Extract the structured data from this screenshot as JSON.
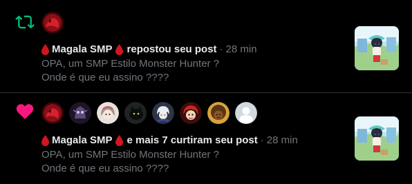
{
  "notifications": [
    {
      "type_icon": "retweet-icon",
      "actor_name": "Magala SMP",
      "action": "repostou seu post",
      "separator": "·",
      "time": "28 min",
      "post_text": "OPA, um SMP Estilo Monster Hunter ?\nOnde é que eu assino ????",
      "accent_color": "#00ba7c"
    },
    {
      "type_icon": "heart-icon",
      "actor_name": "Magala SMP",
      "action": "e mais 7 curtiram seu post",
      "separator": "·",
      "time": "28 min",
      "post_text": "OPA, um SMP Estilo Monster Hunter ?\nOnde é que eu assino ????",
      "accent_color": "#f91880"
    }
  ],
  "colors": {
    "background": "#000000",
    "primary_text": "#e7e9ea",
    "secondary_text": "#71767b",
    "divider": "#2f3336",
    "blood_drop": "#d1161f"
  }
}
